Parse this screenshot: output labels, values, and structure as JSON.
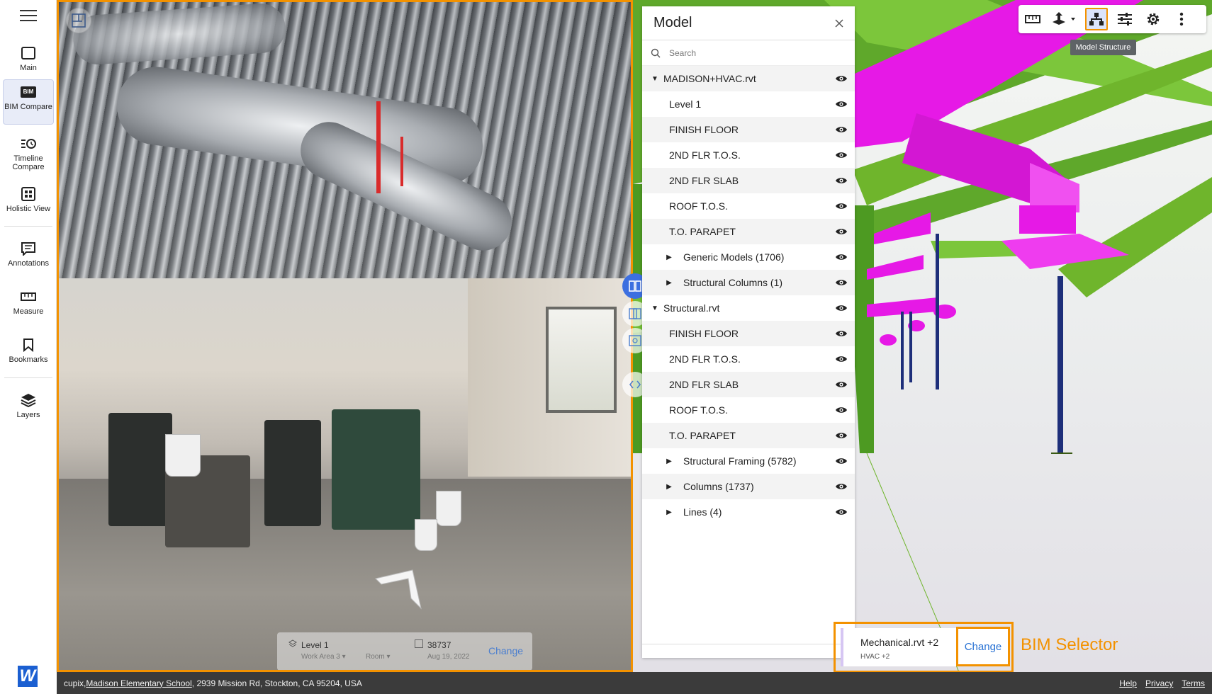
{
  "nav": {
    "items": [
      {
        "label": "Main",
        "icon": "square-icon"
      },
      {
        "label": "BIM Compare",
        "icon": "bim-icon",
        "badge": "BIM",
        "active": true
      },
      {
        "label": "Timeline Compare",
        "icon": "timeline-icon"
      },
      {
        "label": "Holistic View",
        "icon": "grid-icon"
      },
      {
        "label": "Annotations",
        "icon": "annotation-icon"
      },
      {
        "label": "Measure",
        "icon": "ruler-icon"
      },
      {
        "label": "Bookmarks",
        "icon": "bookmark-icon"
      },
      {
        "label": "Layers",
        "icon": "layers-icon"
      }
    ],
    "brand_letter": "W"
  },
  "photo": {
    "location": {
      "level": "Level 1",
      "work_area": "Work Area 3",
      "room": "Room",
      "capture_id": "38737",
      "date": "Aug 19, 2022",
      "change_label": "Change"
    }
  },
  "model_panel": {
    "title": "Model",
    "search_placeholder": "Search",
    "tree": [
      {
        "label": "MADISON+HVAC.rvt",
        "depth": 0,
        "expanded": true
      },
      {
        "label": "Level 1",
        "depth": 1
      },
      {
        "label": "FINISH FLOOR",
        "depth": 1
      },
      {
        "label": "2ND FLR T.O.S.",
        "depth": 1
      },
      {
        "label": "2ND FLR SLAB",
        "depth": 1
      },
      {
        "label": "ROOF T.O.S.",
        "depth": 1
      },
      {
        "label": "T.O. PARAPET",
        "depth": 1
      },
      {
        "label": "Generic Models (1706)",
        "depth": 2,
        "expanded": false
      },
      {
        "label": "Structural Columns (1)",
        "depth": 2,
        "expanded": false
      },
      {
        "label": "Structural.rvt",
        "depth": 0,
        "expanded": true
      },
      {
        "label": "FINISH FLOOR",
        "depth": 1
      },
      {
        "label": "2ND FLR T.O.S.",
        "depth": 1
      },
      {
        "label": "2ND FLR SLAB",
        "depth": 1
      },
      {
        "label": "ROOF T.O.S.",
        "depth": 1
      },
      {
        "label": "T.O. PARAPET",
        "depth": 1
      },
      {
        "label": "Structural Framing (5782)",
        "depth": 2,
        "expanded": false
      },
      {
        "label": "Columns (1737)",
        "depth": 2,
        "expanded": false
      },
      {
        "label": "Lines (4)",
        "depth": 2,
        "expanded": false
      }
    ]
  },
  "toolbar": {
    "buttons": [
      "ruler-icon",
      "section-plane-icon",
      "model-structure-icon",
      "sliders-icon",
      "gear-icon",
      "more-vert-icon"
    ],
    "tooltip": "Model Structure"
  },
  "bim_selector": {
    "name": "Mechanical.rvt +2",
    "sub": "HVAC +2",
    "change_label": "Change",
    "annotation": "BIM Selector"
  },
  "footer": {
    "prefix": "cupix, ",
    "project": "Madison Elementary School",
    "address": ", 2939 Mission Rd, Stockton, CA 95204, USA",
    "links": [
      "Help",
      "Privacy",
      "Terms"
    ]
  },
  "colors": {
    "highlight": "#f39200",
    "accent": "#2a73d4",
    "pipe": "#e619e6",
    "beam": "#6fb52c",
    "column": "#1e2f7a"
  }
}
